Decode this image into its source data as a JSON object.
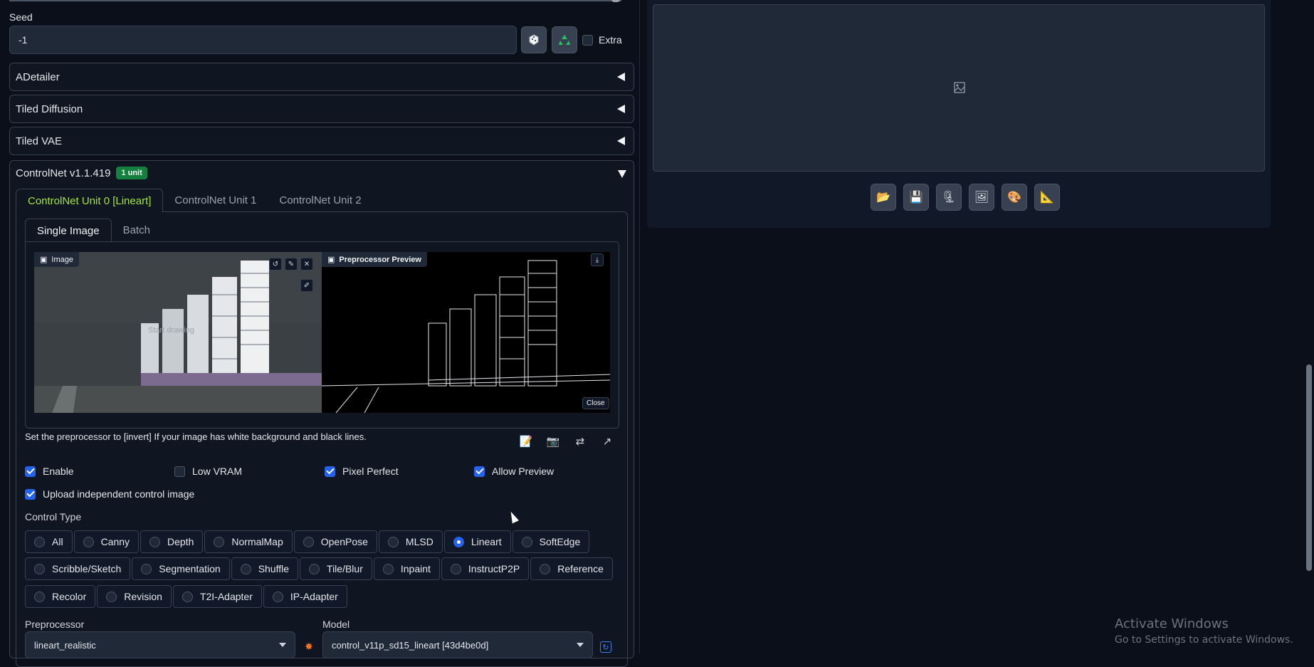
{
  "seed": {
    "label": "Seed",
    "value": "-1",
    "extra_label": "Extra"
  },
  "accordions": [
    {
      "label": "ADetailer"
    },
    {
      "label": "Tiled Diffusion"
    },
    {
      "label": "Tiled VAE"
    }
  ],
  "controlnet": {
    "title": "ControlNet v1.1.419",
    "badge": "1 unit",
    "units": [
      "ControlNet Unit 0 [Lineart]",
      "ControlNet Unit 1",
      "ControlNet Unit 2"
    ],
    "subtabs": [
      "Single Image",
      "Batch"
    ],
    "image_label": "Image",
    "image_watermark": "Start drawing",
    "preview_label": "Preprocessor Preview",
    "close_label": "Close",
    "hint": "Set the preprocessor to [invert] If your image has white background and black lines.",
    "checkboxes": {
      "enable": {
        "label": "Enable",
        "checked": true
      },
      "low_vram": {
        "label": "Low VRAM",
        "checked": false
      },
      "pixel_perfect": {
        "label": "Pixel Perfect",
        "checked": true
      },
      "allow_preview": {
        "label": "Allow Preview",
        "checked": true
      },
      "upload_independent": {
        "label": "Upload independent control image",
        "checked": true
      }
    },
    "control_type_label": "Control Type",
    "control_types_row1": [
      "All",
      "Canny",
      "Depth",
      "NormalMap",
      "OpenPose",
      "MLSD",
      "Lineart",
      "SoftEdge"
    ],
    "control_types_row2": [
      "Scribble/Sketch",
      "Segmentation",
      "Shuffle",
      "Tile/Blur",
      "Inpaint",
      "InstructP2P",
      "Reference"
    ],
    "control_types_row3": [
      "Recolor",
      "Revision",
      "T2I-Adapter",
      "IP-Adapter"
    ],
    "selected_control_type": "Lineart",
    "preprocessor": {
      "label": "Preprocessor",
      "value": "lineart_realistic"
    },
    "model": {
      "label": "Model",
      "value": "control_v11p_sd15_lineart [43d4be0d]"
    }
  },
  "windows_watermark": {
    "line1": "Activate Windows",
    "line2": "Go to Settings to activate Windows."
  },
  "colors": {
    "accent": "#2563eb",
    "active_tab": "#a3e635",
    "badge": "#15803d"
  }
}
